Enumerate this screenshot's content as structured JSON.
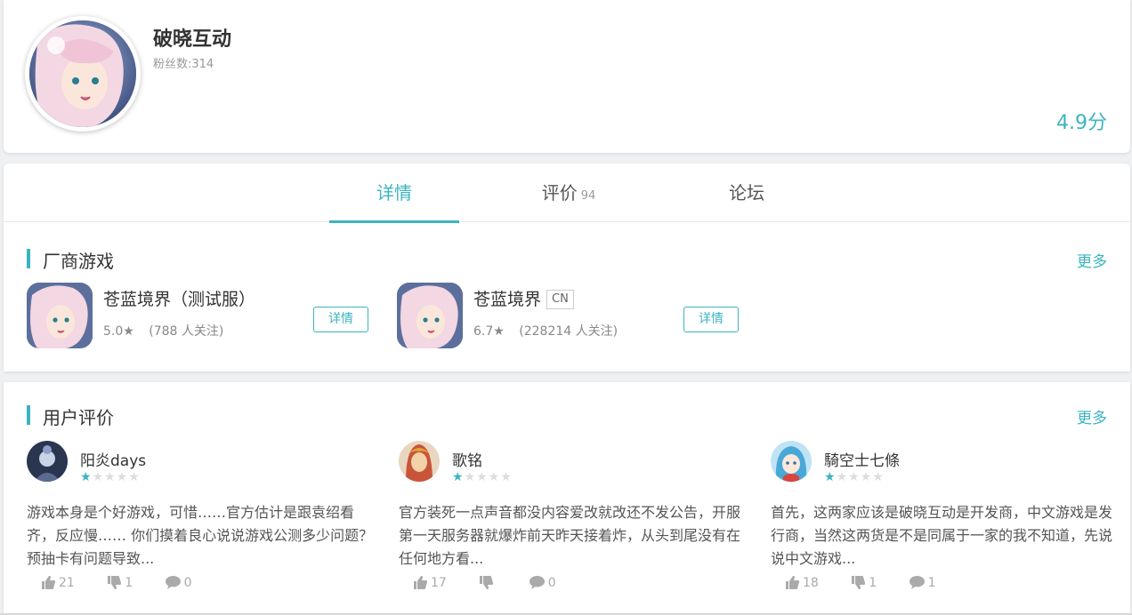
{
  "developer": {
    "name": "破晓互动",
    "fans_label": "粉丝数:314",
    "rating": "4.9分"
  },
  "tabs": [
    {
      "label": "详情",
      "count": "",
      "active": true
    },
    {
      "label": "评价",
      "count": "94",
      "active": false
    },
    {
      "label": "论坛",
      "count": "",
      "active": false
    }
  ],
  "vendor_games": {
    "title": "厂商游戏",
    "more": "更多",
    "items": [
      {
        "name": "苍蓝境界（测试服）",
        "badge": "",
        "score": "5.0",
        "follow": "(788 人关注)",
        "button": "详情"
      },
      {
        "name": "苍蓝境界",
        "badge": "CN",
        "score": "6.7",
        "follow": "(228214 人关注)",
        "button": "详情"
      }
    ]
  },
  "user_reviews": {
    "title": "用户评价",
    "more": "更多",
    "items": [
      {
        "user": "阳炎days",
        "stars": 1,
        "text": "游戏本身是个好游戏，可惜……官方估计是跟袁绍看齐，反应慢…… 你们摸着良心说说游戏公测多少问题？预抽卡有问题导致...",
        "likes": "21",
        "dislikes": "1",
        "comments": "0",
        "avatar_color": "#2a3550"
      },
      {
        "user": "歌铭",
        "stars": 1,
        "text": "官方装死一点声音都没内容爱改就改还不发公告，开服第一天服务器就爆炸前天昨天接着炸，从头到尾没有在任何地方看...",
        "likes": "17",
        "dislikes": "",
        "comments": "0",
        "avatar_color": "#c8553a"
      },
      {
        "user": "騎空士七條",
        "stars": 1,
        "text": "首先，这两家应该是破晓互动是开发商，中文游戏是发行商，当然这两货是不是同属于一家的我不知道，先说说中文游戏...",
        "likes": "18",
        "dislikes": "1",
        "comments": "1",
        "avatar_color": "#4aa8d8"
      }
    ]
  },
  "colors": {
    "accent": "#3bb4c1",
    "text": "#333333",
    "muted": "#999999"
  }
}
